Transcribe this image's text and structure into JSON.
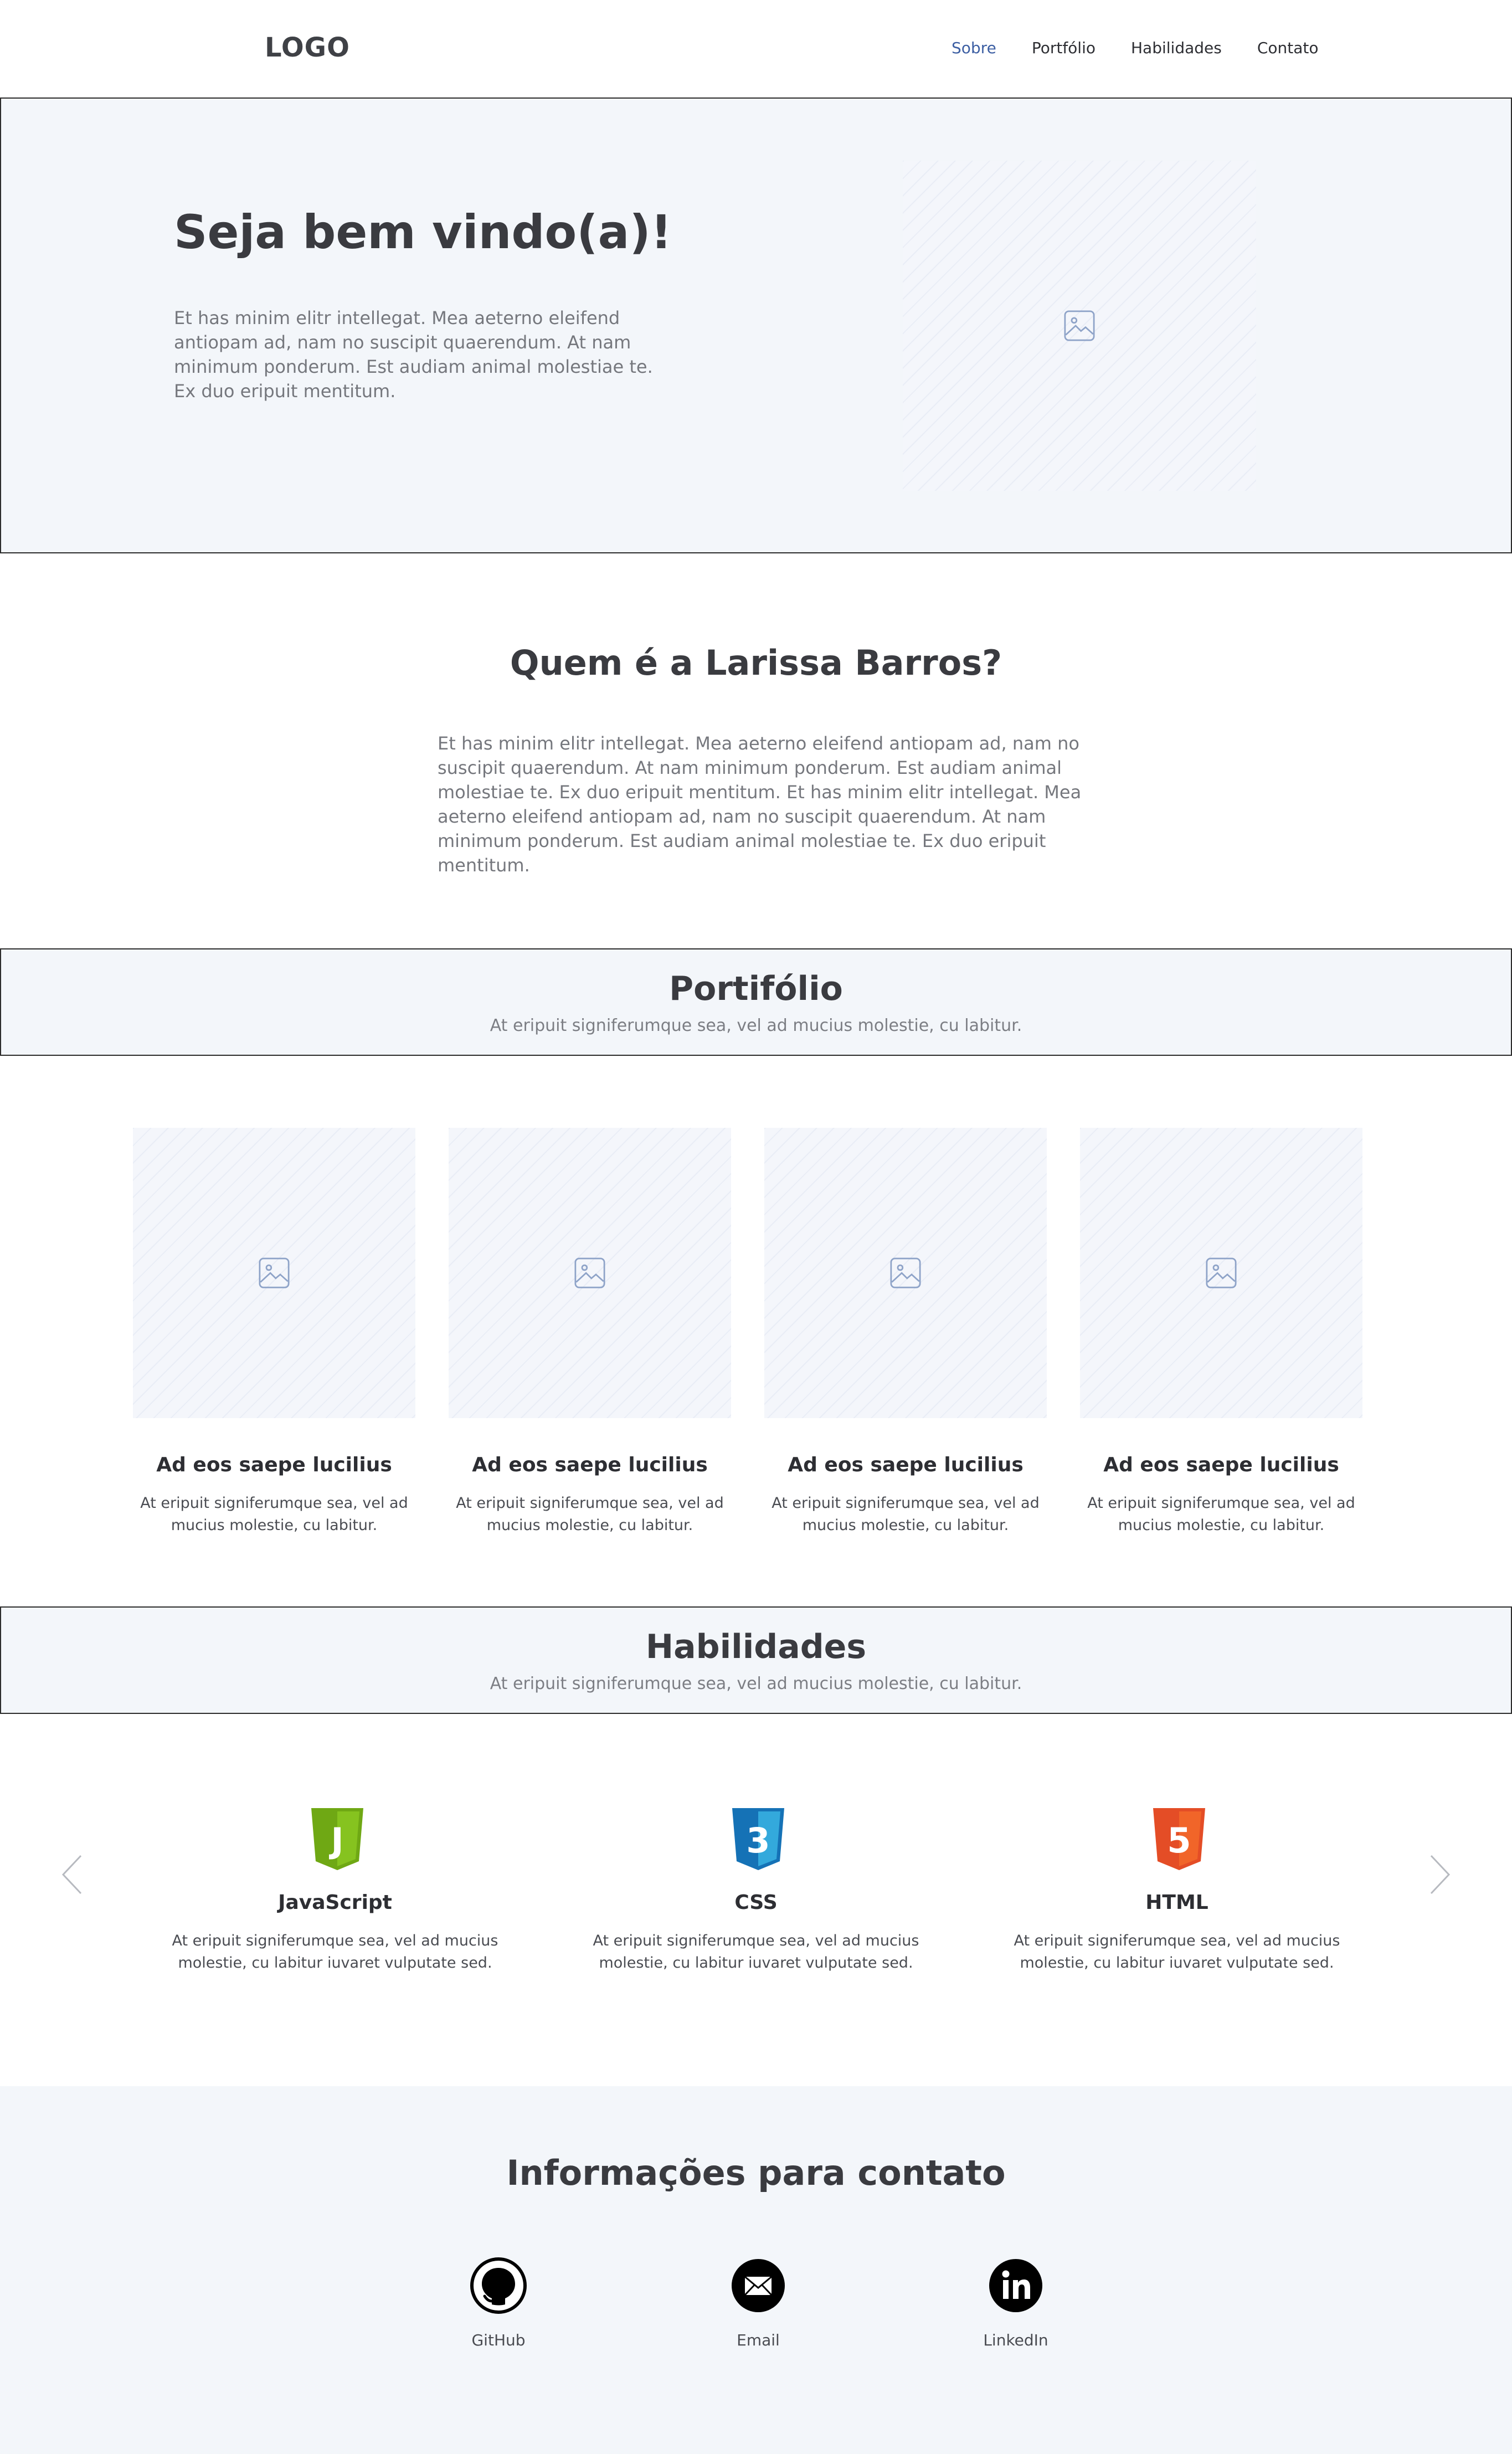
{
  "header": {
    "logo": "LOGO",
    "nav": [
      "Sobre",
      "Portfólio",
      "Habilidades",
      "Contato"
    ]
  },
  "hero": {
    "title": "Seja bem vindo(a)!",
    "text": "Et has minim elitr intellegat. Mea aeterno eleifend antiopam ad, nam no suscipit quaerendum. At nam minimum ponderum. Est audiam animal molestiae te. Ex duo eripuit mentitum."
  },
  "about": {
    "title": "Quem é a Larissa Barros?",
    "text": "Et has minim elitr intellegat. Mea aeterno eleifend antiopam ad, nam no suscipit quaerendum. At nam minimum ponderum. Est audiam animal molestiae te. Ex duo eripuit mentitum. Et has minim elitr intellegat. Mea aeterno eleifend antiopam ad, nam no suscipit quaerendum. At nam minimum ponderum. Est audiam animal molestiae te. Ex duo eripuit mentitum."
  },
  "portfolio": {
    "title": "Portifólio",
    "subtitle": "At eripuit signiferumque sea, vel ad mucius molestie, cu labitur.",
    "items": [
      {
        "title": "Ad eos saepe lucilius",
        "text": "At eripuit signiferumque sea, vel ad mucius molestie, cu labitur."
      },
      {
        "title": "Ad eos saepe lucilius",
        "text": "At eripuit signiferumque sea, vel ad mucius molestie, cu labitur."
      },
      {
        "title": "Ad eos saepe lucilius",
        "text": "At eripuit signiferumque sea, vel ad mucius molestie, cu labitur."
      },
      {
        "title": "Ad eos saepe lucilius",
        "text": "At eripuit signiferumque sea, vel ad mucius molestie, cu labitur."
      }
    ]
  },
  "skills": {
    "title": "Habilidades",
    "subtitle": "At eripuit signiferumque sea, vel ad mucius molestie, cu labitur.",
    "items": [
      {
        "name": "JavaScript",
        "badge": "J",
        "color": "#7cb518",
        "text": "At eripuit signiferumque sea, vel ad mucius molestie, cu labitur iuvaret vulputate sed."
      },
      {
        "name": "CSS",
        "badge": "3",
        "color": "#1572b6",
        "text": "At eripuit signiferumque sea, vel ad mucius molestie, cu labitur iuvaret vulputate sed."
      },
      {
        "name": "HTML",
        "badge": "5",
        "color": "#e44d26",
        "text": "At eripuit signiferumque sea, vel ad mucius molestie, cu labitur iuvaret vulputate sed."
      }
    ]
  },
  "contact": {
    "title": "Informações para contato",
    "items": [
      {
        "label": "GitHub",
        "icon": "github-icon"
      },
      {
        "label": "Email",
        "icon": "email-icon"
      },
      {
        "label": "LinkedIn",
        "icon": "linkedin-icon"
      }
    ]
  },
  "colors": {
    "nav_active": "#3d5fa3",
    "section_bg": "#f3f6fa",
    "placeholder_icon": "#8ea3c8"
  }
}
